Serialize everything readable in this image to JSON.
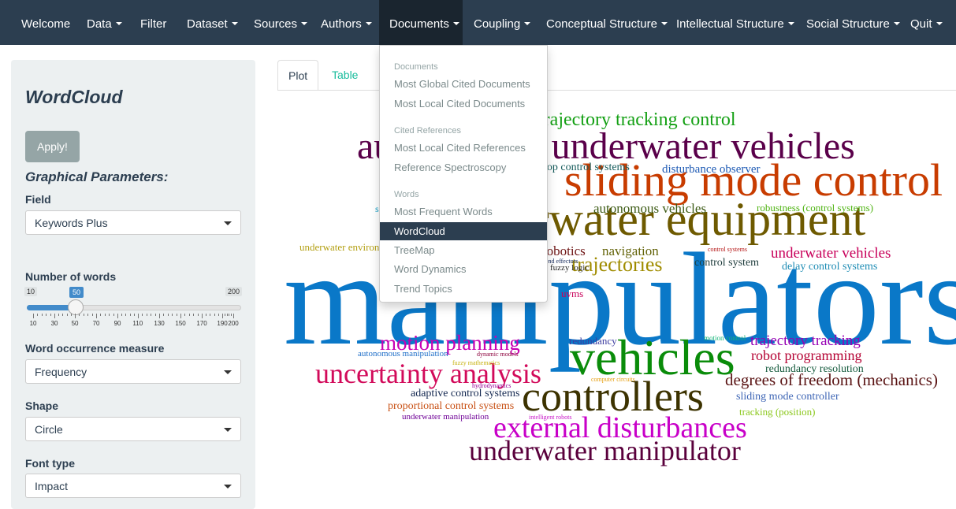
{
  "nav": {
    "items": [
      {
        "label": "Welcome",
        "caret": false
      },
      {
        "label": "Data",
        "caret": true
      },
      {
        "label": "Filter",
        "caret": false
      },
      {
        "label": "Dataset",
        "caret": true
      },
      {
        "label": "Sources",
        "caret": true
      },
      {
        "label": "Authors",
        "caret": true
      },
      {
        "label": "Documents",
        "caret": true
      },
      {
        "label": "Coupling",
        "caret": true
      },
      {
        "label": "Conceptual Structure",
        "caret": true
      },
      {
        "label": "Intellectual Structure",
        "caret": true
      },
      {
        "label": "Social Structure",
        "caret": true
      },
      {
        "label": "Quit",
        "caret": true
      }
    ]
  },
  "sidebar": {
    "title": "WordCloud",
    "apply_label": "Apply!",
    "graphical_params": "Graphical Parameters:",
    "field_label": "Field",
    "field_value": "Keywords Plus",
    "num_words_label": "Number of words",
    "slider": {
      "min": "10",
      "max": "200",
      "value": "50",
      "ticks": [
        "10",
        "30",
        "50",
        "70",
        "90",
        "110",
        "130",
        "150",
        "170",
        "190",
        "200"
      ]
    },
    "occurrence_label": "Word occurrence measure",
    "occurrence_value": "Frequency",
    "shape_label": "Shape",
    "shape_value": "Circle",
    "font_label": "Font type",
    "font_value": "Impact"
  },
  "tabs": {
    "plot": "Plot",
    "table": "Table"
  },
  "dropdown": {
    "header_documents": "Documents",
    "most_global": "Most Global Cited Documents",
    "most_local": "Most Local Cited Documents",
    "header_cited": "Cited References",
    "most_local_refs": "Most Local Cited References",
    "ref_spectroscopy": "Reference Spectroscopy",
    "header_words": "Words",
    "most_frequent": "Most Frequent Words",
    "wordcloud": "WordCloud",
    "treemap": "TreeMap",
    "word_dynamics": "Word Dynamics",
    "trend_topics": "Trend Topics"
  },
  "wordcloud": {
    "words": [
      {
        "text": "manipulators",
        "color": "#0a78c8"
      },
      {
        "text": "autonomous underwater vehicles",
        "color": "#5a004a"
      },
      {
        "text": "sliding mode control",
        "color": "#c83c00"
      },
      {
        "text": "underwater equipment",
        "color": "#6e5a00"
      },
      {
        "text": "vehicles",
        "color": "#0a8c0a"
      },
      {
        "text": "controllers",
        "color": "#3c3200"
      },
      {
        "text": "external disturbances",
        "color": "#c800c8"
      },
      {
        "text": "underwater manipulator",
        "color": "#5a003c"
      },
      {
        "text": "uncertainty analysis",
        "color": "#d20a5a"
      },
      {
        "text": "motion planning",
        "color": "#c800b4"
      },
      {
        "text": "trajectory tracking control",
        "color": "#14a014"
      },
      {
        "text": "trajectories",
        "color": "#a08c00"
      },
      {
        "text": "degrees of freedom (mechanics)",
        "color": "#5a1414"
      },
      {
        "text": "underwater vehicles",
        "color": "#c8005a"
      },
      {
        "text": "trajectory tracking",
        "color": "#9600b4"
      },
      {
        "text": "robot programming",
        "color": "#b40032"
      },
      {
        "text": "autonomous vehicles",
        "color": "#3c5a14"
      },
      {
        "text": "navigation",
        "color": "#64640a"
      },
      {
        "text": "disturbance observer",
        "color": "#1e5ab4"
      },
      {
        "text": "robotics",
        "color": "#6e1414"
      },
      {
        "text": "loop control systems",
        "color": "#145a5a"
      },
      {
        "text": "robustness (control systems)",
        "color": "#50b414"
      },
      {
        "text": "control system",
        "color": "#1e3c3c"
      },
      {
        "text": "delay control systems",
        "color": "#1e8cb4"
      },
      {
        "text": "redundancy resolution",
        "color": "#145a3c"
      },
      {
        "text": "sliding mode controller",
        "color": "#3c64b4"
      },
      {
        "text": "tracking (position)",
        "color": "#8cc81e"
      },
      {
        "text": "adaptive control systems",
        "color": "#142850"
      },
      {
        "text": "proportional control systems",
        "color": "#c85014"
      },
      {
        "text": "underwater manipulation",
        "color": "#6e0096"
      },
      {
        "text": "autonomous manipulation",
        "color": "#1e6ec8"
      },
      {
        "text": "redundancy",
        "color": "#3c3ca0"
      },
      {
        "text": "underwater environments",
        "color": "#b4a014"
      },
      {
        "text": "uvms",
        "color": "#c8005a"
      },
      {
        "text": "motion control",
        "color": "#14b478"
      },
      {
        "text": "control systems",
        "color": "#b41414"
      },
      {
        "text": "dynamic models",
        "color": "#8c003c"
      },
      {
        "text": "fuzzy mathematics",
        "color": "#c8b414"
      },
      {
        "text": "hydrodynamics",
        "color": "#960096"
      },
      {
        "text": "computer circuits",
        "color": "#e6a014"
      },
      {
        "text": "intelligent robots",
        "color": "#c814c8"
      },
      {
        "text": "end effectors",
        "color": "#14285a"
      },
      {
        "text": "fuzzy logic",
        "color": "#282828"
      },
      {
        "text": "s",
        "color": "#14a0c8"
      }
    ]
  }
}
